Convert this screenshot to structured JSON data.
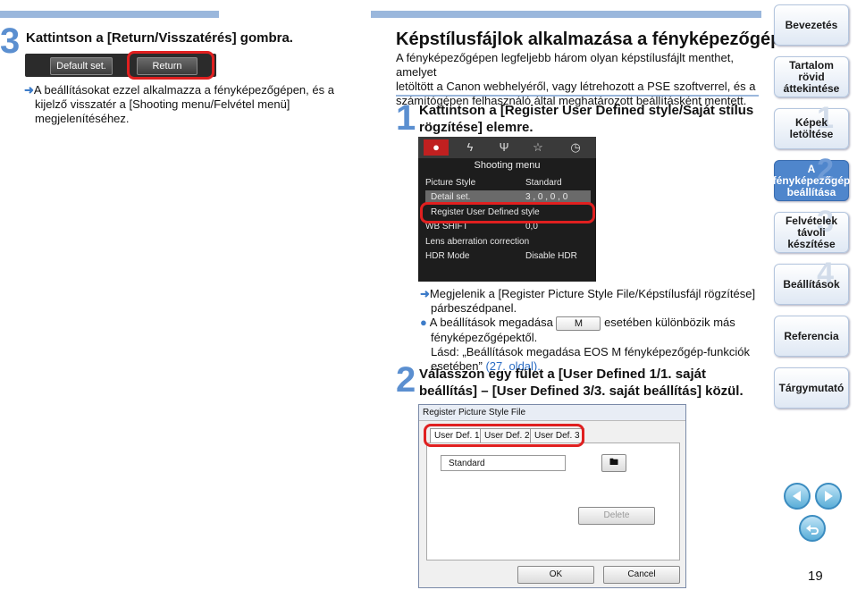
{
  "left": {
    "step_num": "3",
    "step_text": "Kattintson a [Return/Visszatérés] gombra.",
    "buttons": [
      "Default set.",
      "Return"
    ],
    "result_lines": [
      "A beállításokat ezzel alkalmazza a fényképezőgépen, és a",
      "kijelző visszatér a [Shooting menu/Felvétel menü]",
      "megjelenítéséhez."
    ]
  },
  "main": {
    "title": "Képstílusfájlok alkalmazása a fényképezőgépen",
    "intro_lines": [
      "A fényképezőgépen legfeljebb három olyan képstílusfájlt menthet, amelyet",
      "letöltött a Canon webhelyéről, vagy létrehozott a PSE szoftverrel, és a",
      "számítógépen felhasználó által meghatározott beállításként mentett."
    ],
    "step1_num": "1",
    "step1_lines": [
      "Kattintson a [Register User Defined style/Saját stílus",
      "rögzítése] elemre."
    ],
    "menu": {
      "tabs": [
        "●",
        "ϟ",
        "Ψ",
        "☆",
        "◷"
      ],
      "title": "Shooting menu",
      "rows": [
        {
          "label": "Picture Style",
          "value": "Standard"
        },
        {
          "label": "Detail set.",
          "value": "3 , 0 , 0 , 0"
        },
        {
          "label": "Register User Defined style",
          "value": ""
        },
        {
          "label": "WB SHIFT",
          "value": "0,0"
        },
        {
          "label": "Lens aberration correction",
          "value": ""
        },
        {
          "label": "HDR Mode",
          "value": "Disable HDR"
        }
      ]
    },
    "result1_lines": [
      "Megjelenik a [Register Picture Style File/Képstílusfájl rögzítése]",
      "párbeszédpanel."
    ],
    "note_pre": "A beállítások megadása",
    "note_box": "M",
    "note_post": "esetében különbözik más",
    "note_line2": "fényképezőgépektől.",
    "note_line3": "Lásd: „Beállítások megadása EOS M fényképezőgép-funkciók",
    "note_line4_a": "esetében” ",
    "note_line4_link": "(27. oldal).",
    "step2_num": "2",
    "step2_lines": [
      "Válasszon egy fület a [User Defined 1/1. saját",
      "beállítás] – [User Defined 3/3. saját beállítás] közül."
    ],
    "dialog": {
      "title": "Register Picture Style File",
      "tabs": [
        "User Def. 1",
        "User Def. 2",
        "User Def. 3"
      ],
      "select": "Standard",
      "delete": "Delete",
      "ok": "OK",
      "cancel": "Cancel"
    }
  },
  "nav": {
    "items": [
      {
        "label": "Bevezetés",
        "num": ""
      },
      {
        "label": "Tartalom rövid áttekintése",
        "num": ""
      },
      {
        "label": "Képek letöltése",
        "num": "1"
      },
      {
        "label": "A fényképezőgép beállítása",
        "num": "2"
      },
      {
        "label": "Felvételek távoli készítése",
        "num": "3"
      },
      {
        "label": "Beállítások",
        "num": "4"
      },
      {
        "label": "Referencia",
        "num": ""
      },
      {
        "label": "Tárgymutató",
        "num": ""
      }
    ]
  },
  "page_number": "19"
}
